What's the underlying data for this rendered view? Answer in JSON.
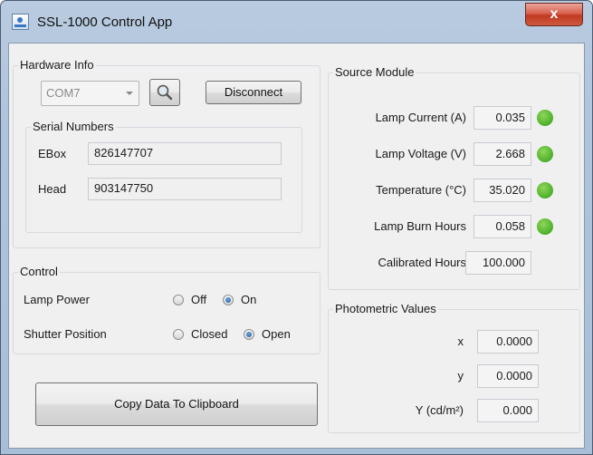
{
  "window": {
    "title": "SSL-1000 Control App",
    "close_glyph": "x"
  },
  "hardware": {
    "group_label": "Hardware Info",
    "port": "COM7",
    "disconnect_label": "Disconnect",
    "serial_group_label": "Serial Numbers",
    "ebox_label": "EBox",
    "ebox_value": "826147707",
    "head_label": "Head",
    "head_value": "903147750"
  },
  "control": {
    "group_label": "Control",
    "lamp_power_label": "Lamp Power",
    "off_label": "Off",
    "on_label": "On",
    "shutter_label": "Shutter Position",
    "closed_label": "Closed",
    "open_label": "Open",
    "lamp_power_selected": "On",
    "shutter_selected": "Open"
  },
  "copy_button_label": "Copy Data To Clipboard",
  "source": {
    "group_label": "Source Module",
    "rows": [
      {
        "label": "Lamp Current (A)",
        "value": "0.035",
        "status_color": "#4caf2a"
      },
      {
        "label": "Lamp Voltage (V)",
        "value": "2.668",
        "status_color": "#4caf2a"
      },
      {
        "label": "Temperature (°C)",
        "value": "35.020",
        "status_color": "#4caf2a"
      },
      {
        "label": "Lamp Burn Hours",
        "value": "0.058",
        "status_color": "#4caf2a"
      },
      {
        "label": "Calibrated Hours",
        "value": "100.000"
      }
    ]
  },
  "photometric": {
    "group_label": "Photometric Values",
    "rows": [
      {
        "label": "x",
        "value": "0.0000"
      },
      {
        "label": "y",
        "value": "0.0000"
      },
      {
        "label": "Y (cd/m²)",
        "value": "0.000"
      }
    ]
  }
}
